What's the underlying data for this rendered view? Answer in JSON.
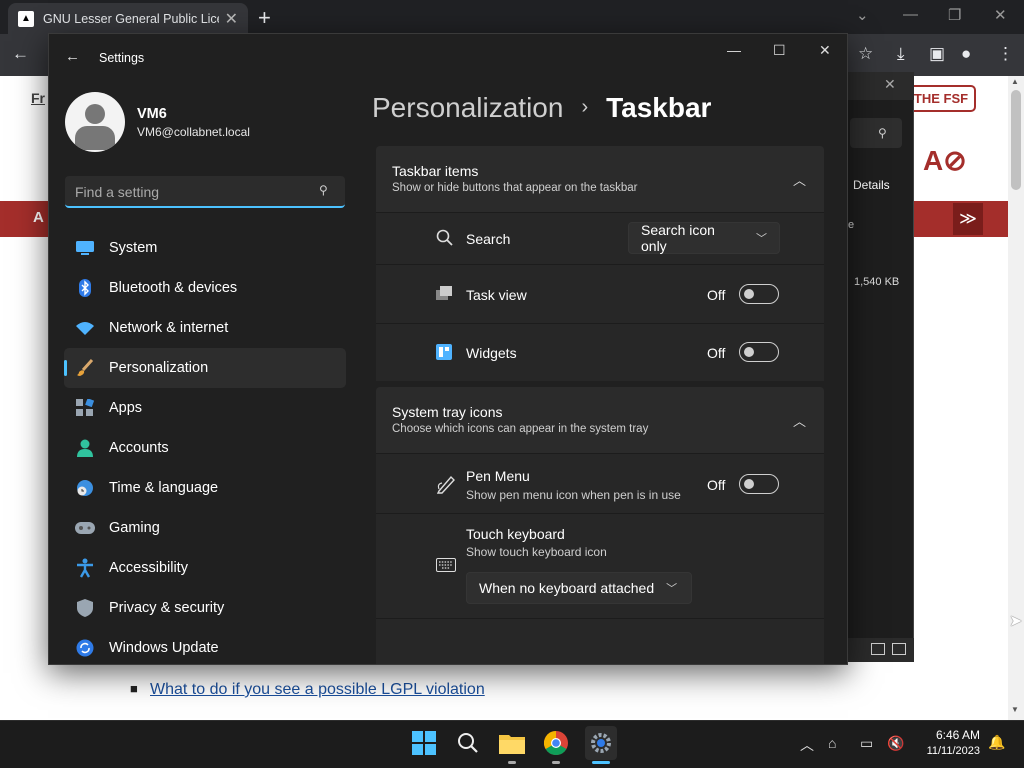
{
  "browser": {
    "tab_title": "GNU Lesser General Public Licen",
    "fsf_button": "THE FSF",
    "page_fr": "Fr",
    "page_link": "What to do if you see a possible LGPL violation",
    "redbar_text": "A",
    "download_panel": {
      "details_label": "Details",
      "size": "1,540 KB",
      "partial": "e"
    }
  },
  "settings": {
    "window_title": "Settings",
    "user": {
      "name": "VM6",
      "email": "VM6@collabnet.local"
    },
    "search_placeholder": "Find a setting",
    "nav": [
      {
        "label": "System",
        "icon": "monitor-icon"
      },
      {
        "label": "Bluetooth & devices",
        "icon": "bluetooth-icon"
      },
      {
        "label": "Network & internet",
        "icon": "wifi-icon"
      },
      {
        "label": "Personalization",
        "icon": "brush-icon",
        "active": true
      },
      {
        "label": "Apps",
        "icon": "apps-icon"
      },
      {
        "label": "Accounts",
        "icon": "person-icon"
      },
      {
        "label": "Time & language",
        "icon": "globe-clock-icon"
      },
      {
        "label": "Gaming",
        "icon": "gamepad-icon"
      },
      {
        "label": "Accessibility",
        "icon": "accessibility-icon"
      },
      {
        "label": "Privacy & security",
        "icon": "shield-icon"
      },
      {
        "label": "Windows Update",
        "icon": "update-icon"
      }
    ],
    "breadcrumb": {
      "parent": "Personalization",
      "separator": "›",
      "current": "Taskbar"
    },
    "taskbar_items": {
      "title": "Taskbar items",
      "subtitle": "Show or hide buttons that appear on the taskbar",
      "search": {
        "label": "Search",
        "value": "Search icon only"
      },
      "task_view": {
        "label": "Task view",
        "state": "Off"
      },
      "widgets": {
        "label": "Widgets",
        "state": "Off"
      }
    },
    "system_tray": {
      "title": "System tray icons",
      "subtitle": "Choose which icons can appear in the system tray",
      "pen_menu": {
        "label": "Pen Menu",
        "sub": "Show pen menu icon when pen is in use",
        "state": "Off"
      },
      "touch_keyboard": {
        "label": "Touch keyboard",
        "sub": "Show touch keyboard icon",
        "value": "When no keyboard attached"
      }
    }
  },
  "taskbar": {
    "time": "6:46 AM",
    "date": "11/11/2023",
    "accent": "#4cc2ff"
  }
}
